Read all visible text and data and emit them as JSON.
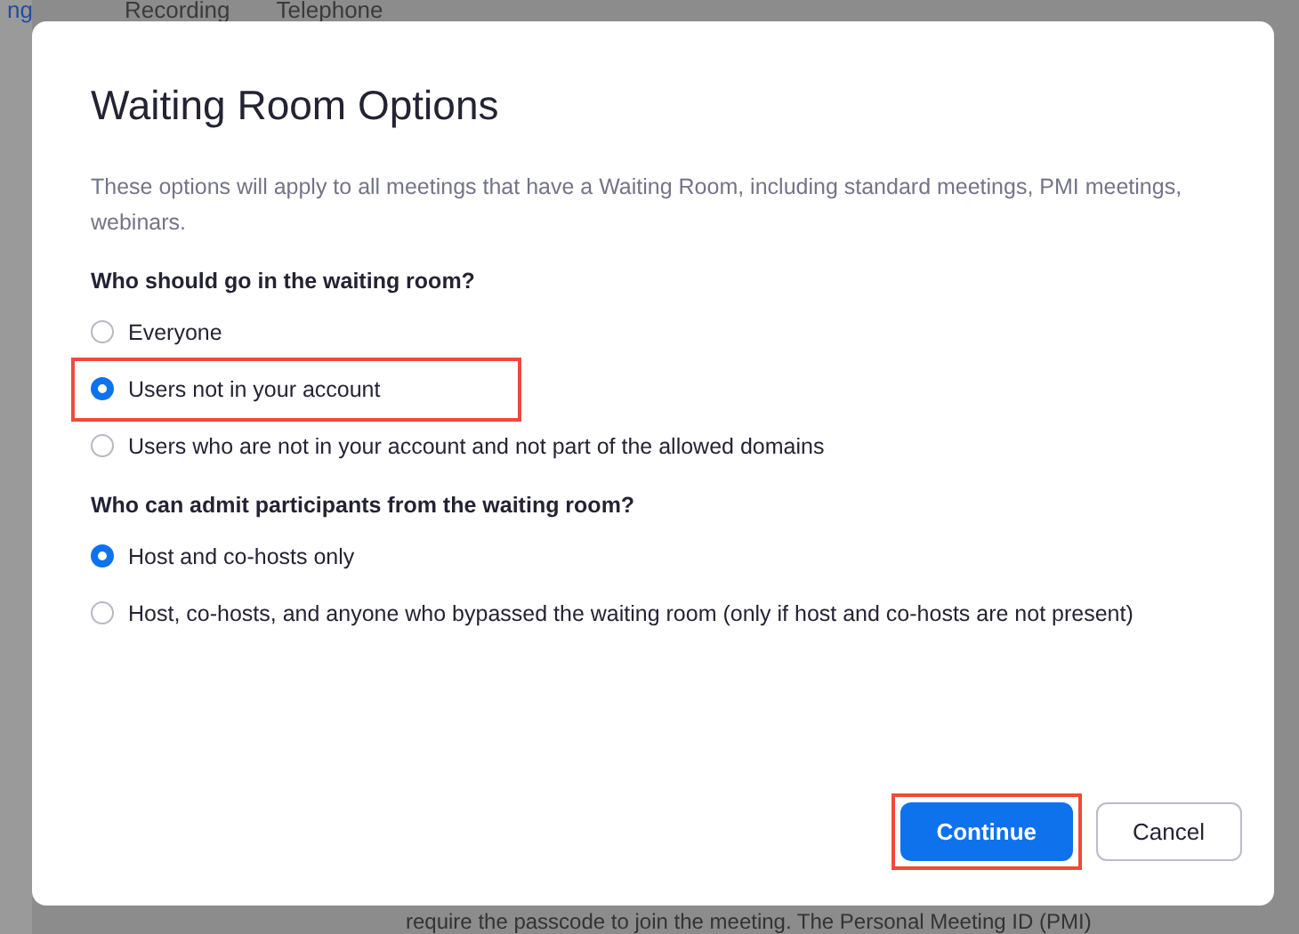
{
  "background_page": {
    "tabs": [
      {
        "label": "ng",
        "selected": true
      },
      {
        "label": "Recording",
        "selected": false
      },
      {
        "label": "Telephone",
        "selected": false
      }
    ],
    "footer_text": "require the passcode to join the meeting. The Personal Meeting ID (PMI)"
  },
  "dialog": {
    "title": "Waiting Room Options",
    "description": "These options will apply to all meetings that have a Waiting Room, including standard meetings, PMI meetings, webinars.",
    "groups": [
      {
        "heading": "Who should go in the waiting room?",
        "options": [
          {
            "label": "Everyone",
            "selected": false,
            "highlighted": false
          },
          {
            "label": "Users not in your account",
            "selected": true,
            "highlighted": true
          },
          {
            "label": "Users who are not in your account and not part of the allowed domains",
            "selected": false,
            "highlighted": false
          }
        ]
      },
      {
        "heading": "Who can admit participants from the waiting room?",
        "options": [
          {
            "label": "Host and co-hosts only",
            "selected": true,
            "highlighted": false
          },
          {
            "label": "Host, co-hosts, and anyone who bypassed the waiting room (only if host and co-hosts are not present)",
            "selected": false,
            "highlighted": false
          }
        ]
      }
    ],
    "buttons": [
      {
        "label": "Continue",
        "kind": "primary",
        "highlighted": true
      },
      {
        "label": "Cancel",
        "kind": "secondary",
        "highlighted": false
      }
    ]
  }
}
